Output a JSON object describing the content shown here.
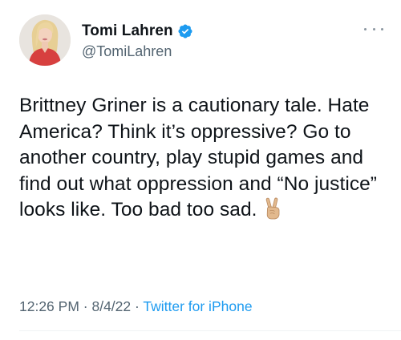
{
  "author": {
    "display_name": "Tomi Lahren",
    "handle": "@TomiLahren",
    "verified": true
  },
  "tweet": {
    "text": "Brittney Griner is a cautionary tale. Hate America? Think it’s oppressive? Go to another country, play stupid games and find out what oppression and “No justice” looks like. Too bad too sad.",
    "emoji": "victory-hand-emoji"
  },
  "meta": {
    "time": "12:26 PM",
    "separator1": " · ",
    "date": "8/4/22",
    "separator2": " · ",
    "source": "Twitter for iPhone"
  },
  "icons": {
    "more": "more-options-icon",
    "verified": "verified-badge-icon"
  },
  "colors": {
    "accent": "#1d9bf0",
    "text": "#0f1419",
    "secondary": "#536471"
  }
}
